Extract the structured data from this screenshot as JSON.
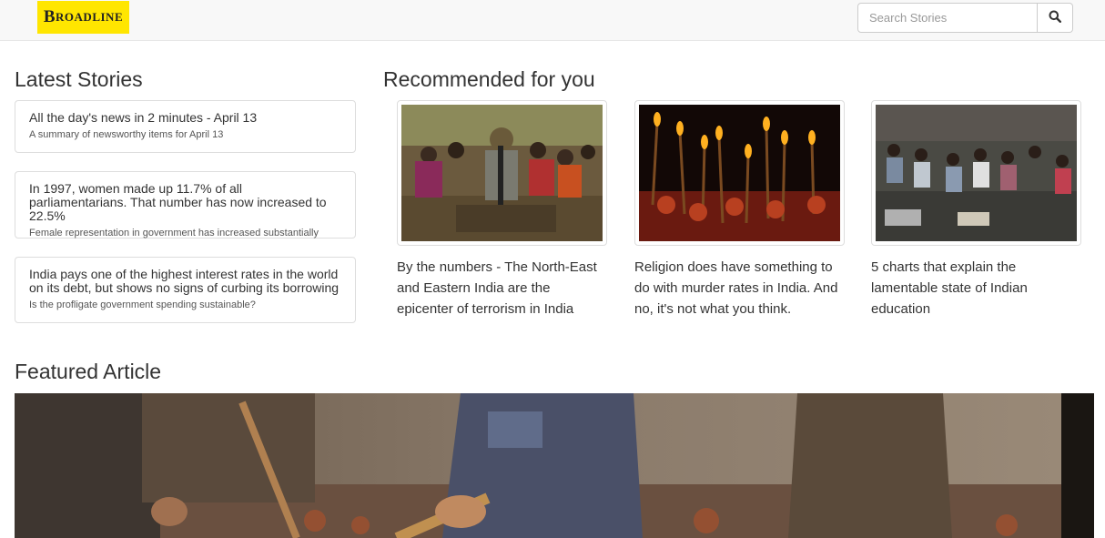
{
  "header": {
    "logo_text": "Broadline",
    "search_placeholder": "Search Stories",
    "search_icon": "search-icon"
  },
  "latest": {
    "title": "Latest Stories",
    "items": [
      {
        "headline": "All the day's news in 2 minutes - April 13",
        "summary": "A summary of newsworthy items for April 13"
      },
      {
        "headline": "In 1997, women made up 11.7% of all parliamentarians. That number has now increased to 22.5%",
        "summary": "Female representation in government has increased substantially"
      },
      {
        "headline": "India pays one of the highest interest rates in the world on its debt, but shows no signs of curbing its borrowing",
        "summary": "Is the profligate government spending sustainable?"
      }
    ]
  },
  "recommended": {
    "title": "Recommended for you",
    "items": [
      {
        "title": "By the numbers - The North-East and Eastern India are the epicenter of terrorism in India"
      },
      {
        "title": "Religion does have something to do with murder rates in India. And no, it's not what you think."
      },
      {
        "title": "5 charts that explain the lamentable state of Indian education"
      }
    ]
  },
  "featured": {
    "title": "Featured Article"
  },
  "colors": {
    "logo_bg": "#ffe600",
    "navbar_bg": "#f8f8f8",
    "border": "#dddddd",
    "text": "#333333"
  }
}
